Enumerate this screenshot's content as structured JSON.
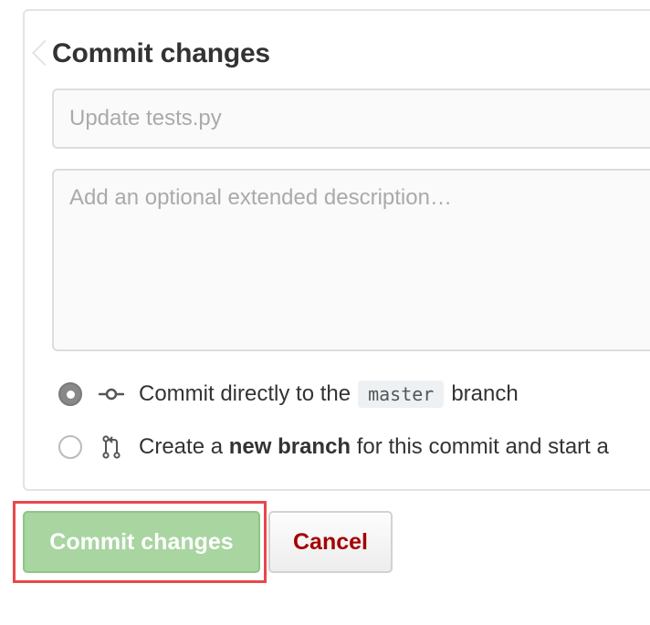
{
  "form": {
    "title": "Commit changes",
    "summary_placeholder": "Update tests.py",
    "description_placeholder": "Add an optional extended description…"
  },
  "options": {
    "direct": {
      "selected": true,
      "icon": "git-commit-icon",
      "text_before": "Commit directly to the",
      "branch": "master",
      "text_after": "branch"
    },
    "new_branch": {
      "selected": false,
      "icon": "git-pull-request-icon",
      "text_before": "Create a",
      "bold": "new branch",
      "text_after": "for this commit and start a"
    }
  },
  "actions": {
    "commit_label": "Commit changes",
    "cancel_label": "Cancel"
  },
  "colors": {
    "commit_button": "#a8d5a0",
    "cancel_text": "#a50000",
    "highlight": "#e9474a"
  }
}
